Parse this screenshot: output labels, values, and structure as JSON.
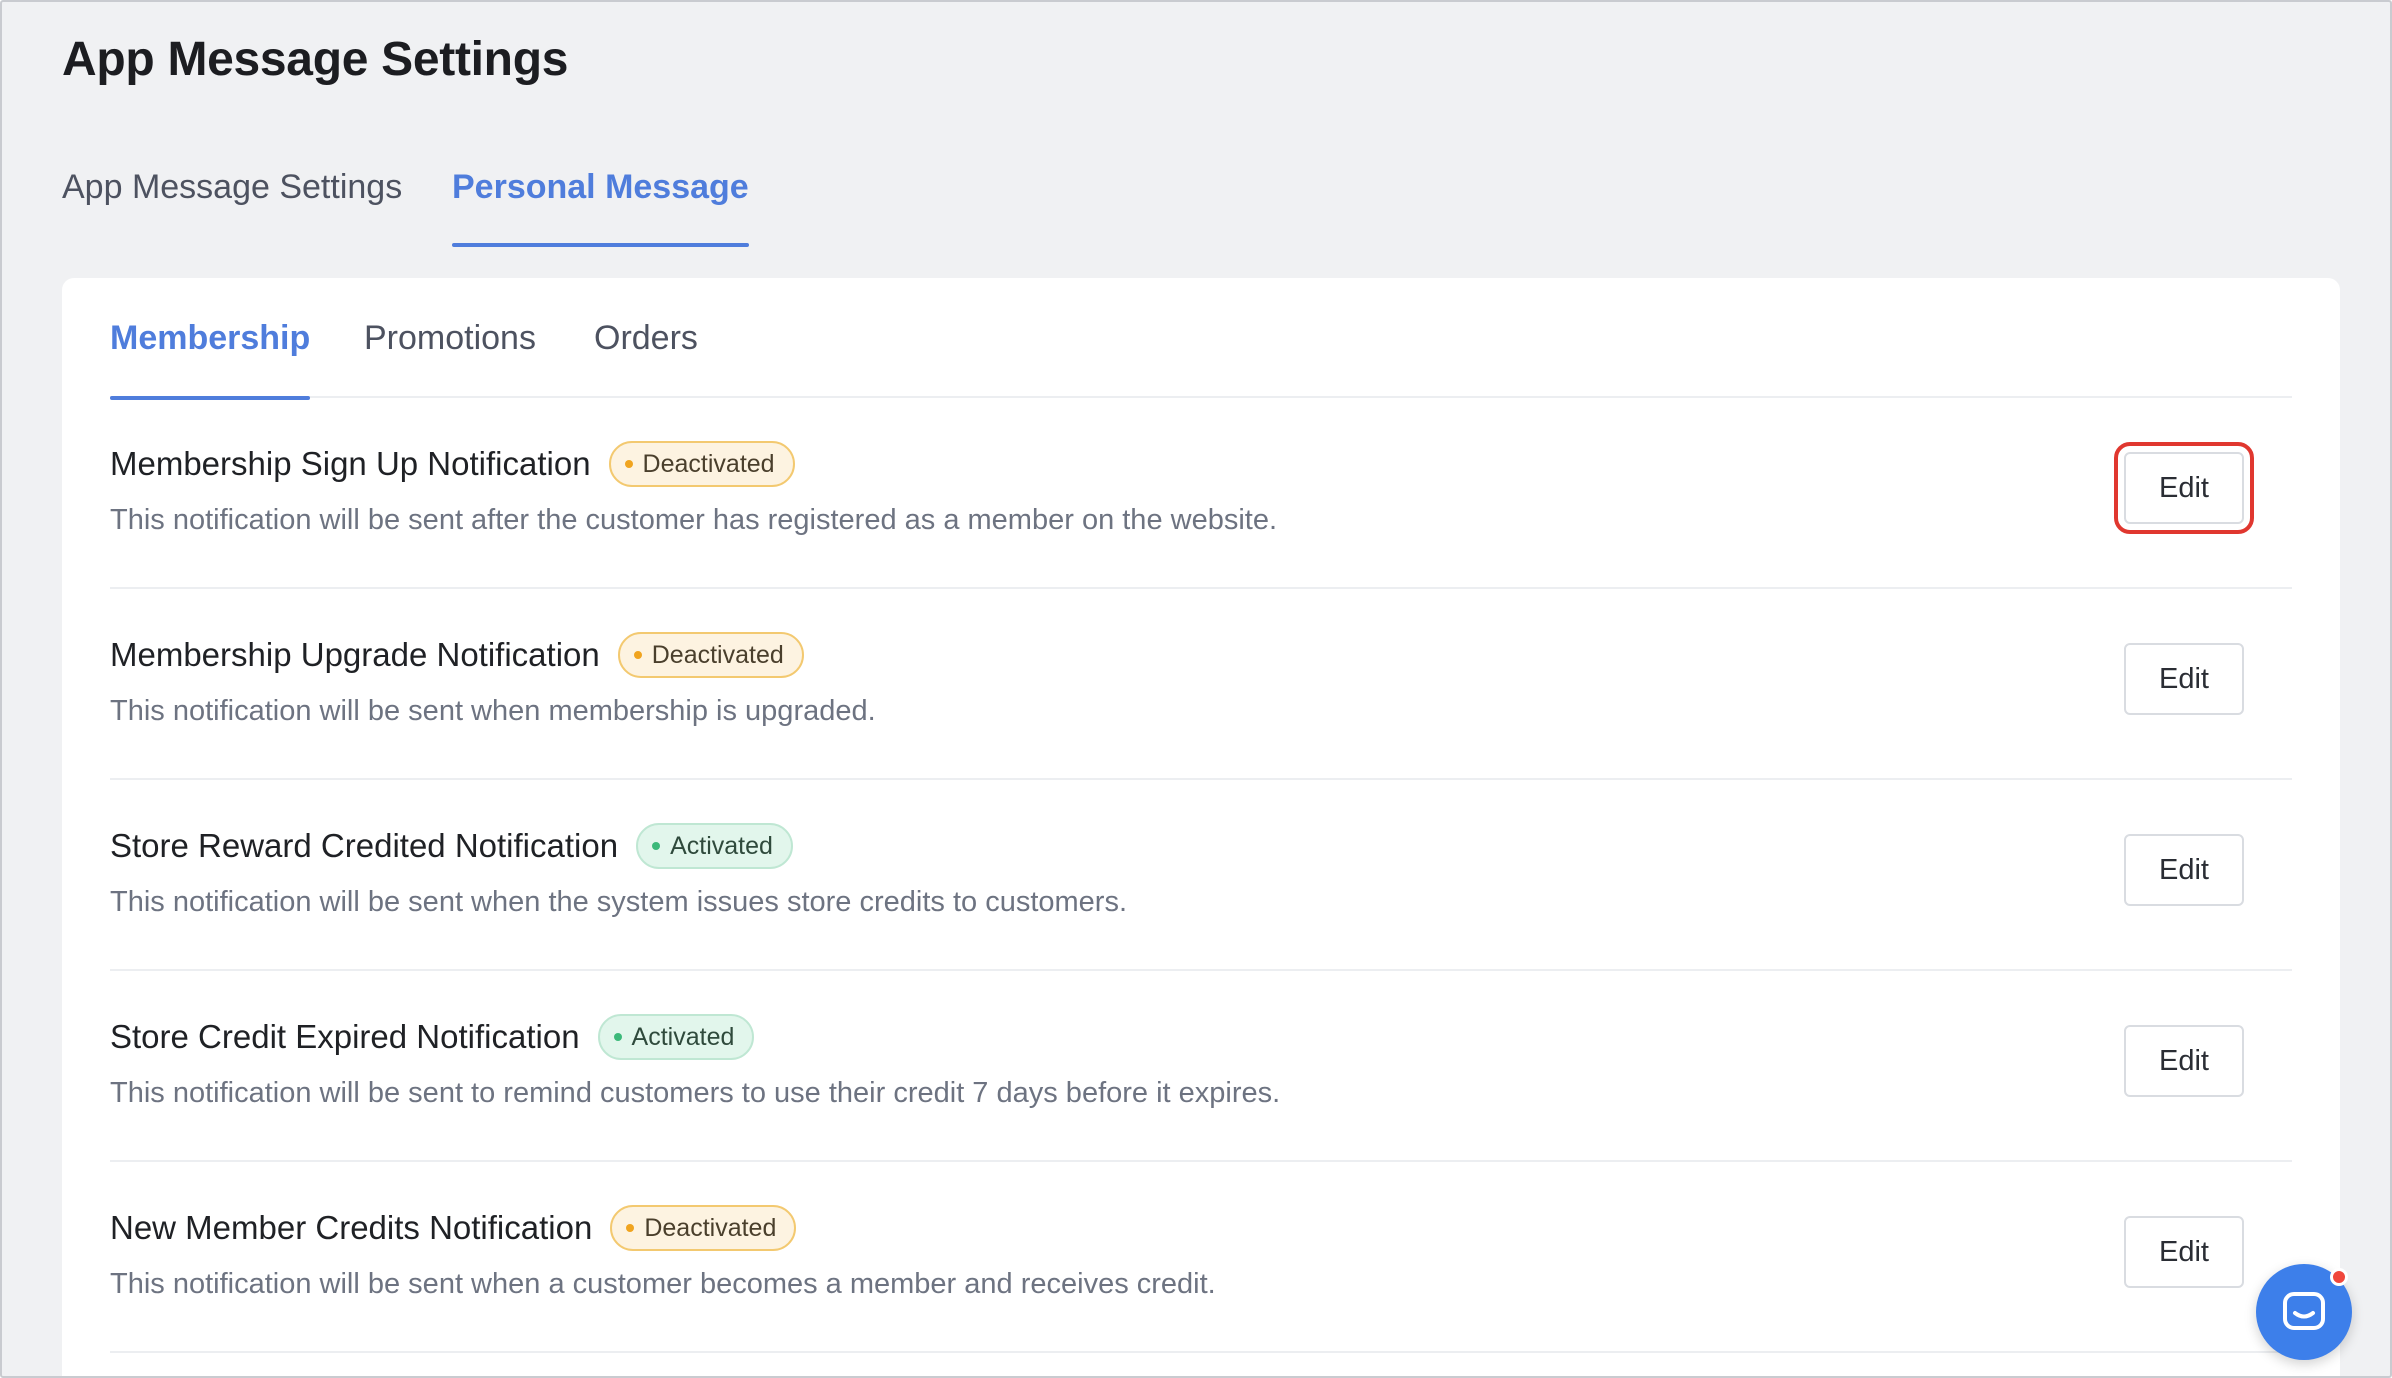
{
  "header": {
    "title": "App Message Settings"
  },
  "top_tabs": [
    {
      "label": "App Message Settings",
      "active": false
    },
    {
      "label": "Personal Message",
      "active": true
    }
  ],
  "sub_tabs": [
    {
      "label": "Membership",
      "active": true
    },
    {
      "label": "Promotions",
      "active": false
    },
    {
      "label": "Orders",
      "active": false
    }
  ],
  "status_colors": {
    "deactivated": "#f0a41f",
    "activated": "#3cb97a",
    "accent": "#4f7ddc",
    "highlight": "#e0372f"
  },
  "notifications": [
    {
      "title": "Membership Sign Up Notification",
      "status": "Deactivated",
      "description": "This notification will be sent after the customer has registered as a member on the website.",
      "action": "Edit"
    },
    {
      "title": "Membership Upgrade Notification",
      "status": "Deactivated",
      "description": "This notification will be sent when membership is upgraded.",
      "action": "Edit"
    },
    {
      "title": "Store Reward Credited Notification",
      "status": "Activated",
      "description": "This notification will be sent when the system issues store credits to customers.",
      "action": "Edit"
    },
    {
      "title": "Store Credit Expired Notification",
      "status": "Activated",
      "description": "This notification will be sent to remind customers to use their credit 7 days before it expires.",
      "action": "Edit"
    },
    {
      "title": "New Member Credits Notification",
      "status": "Deactivated",
      "description": "This notification will be sent when a customer becomes a member and receives credit.",
      "action": "Edit"
    }
  ],
  "chat_widget": {
    "icon": "chat-bubble-icon",
    "has_unread": true
  }
}
